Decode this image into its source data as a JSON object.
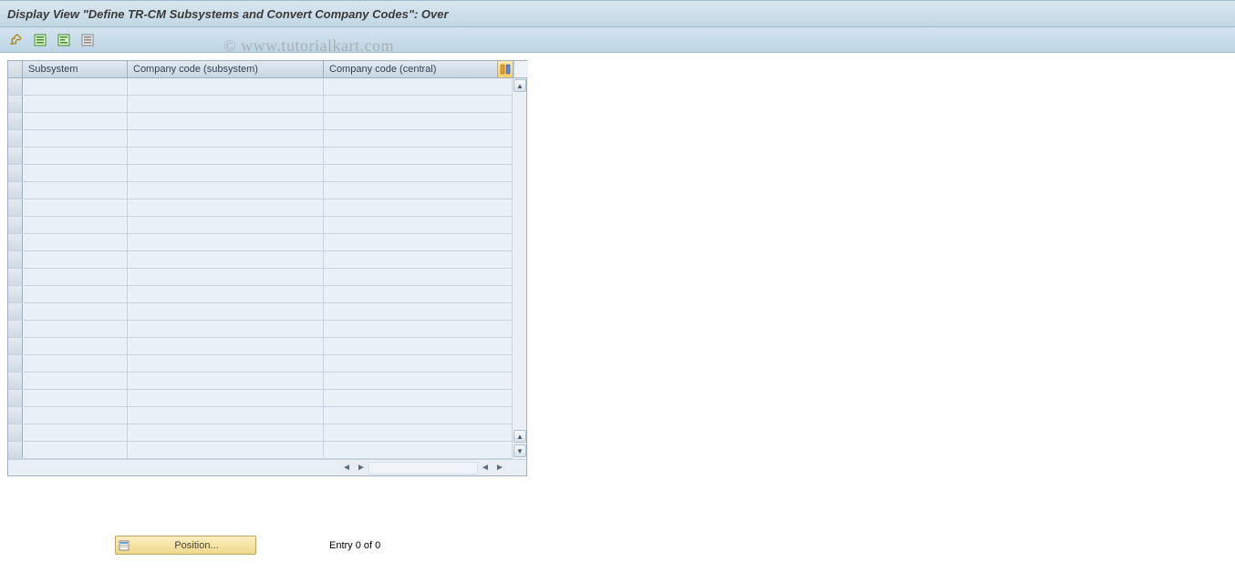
{
  "title": "Display View \"Define TR-CM Subsystems and Convert Company Codes\": Over",
  "toolbar": {
    "icons": [
      "edit-icon",
      "doc-icon",
      "doc2-icon",
      "doc3-icon"
    ]
  },
  "table": {
    "columns": {
      "subsystem": "Subsystem",
      "company_sub": "Company code (subsystem)",
      "company_cen": "Company code (central)"
    },
    "rows": [
      {
        "subsystem": "",
        "company_sub": "",
        "company_cen": ""
      },
      {
        "subsystem": "",
        "company_sub": "",
        "company_cen": ""
      },
      {
        "subsystem": "",
        "company_sub": "",
        "company_cen": ""
      },
      {
        "subsystem": "",
        "company_sub": "",
        "company_cen": ""
      },
      {
        "subsystem": "",
        "company_sub": "",
        "company_cen": ""
      },
      {
        "subsystem": "",
        "company_sub": "",
        "company_cen": ""
      },
      {
        "subsystem": "",
        "company_sub": "",
        "company_cen": ""
      },
      {
        "subsystem": "",
        "company_sub": "",
        "company_cen": ""
      },
      {
        "subsystem": "",
        "company_sub": "",
        "company_cen": ""
      },
      {
        "subsystem": "",
        "company_sub": "",
        "company_cen": ""
      },
      {
        "subsystem": "",
        "company_sub": "",
        "company_cen": ""
      },
      {
        "subsystem": "",
        "company_sub": "",
        "company_cen": ""
      },
      {
        "subsystem": "",
        "company_sub": "",
        "company_cen": ""
      },
      {
        "subsystem": "",
        "company_sub": "",
        "company_cen": ""
      },
      {
        "subsystem": "",
        "company_sub": "",
        "company_cen": ""
      },
      {
        "subsystem": "",
        "company_sub": "",
        "company_cen": ""
      },
      {
        "subsystem": "",
        "company_sub": "",
        "company_cen": ""
      },
      {
        "subsystem": "",
        "company_sub": "",
        "company_cen": ""
      },
      {
        "subsystem": "",
        "company_sub": "",
        "company_cen": ""
      },
      {
        "subsystem": "",
        "company_sub": "",
        "company_cen": ""
      },
      {
        "subsystem": "",
        "company_sub": "",
        "company_cen": ""
      },
      {
        "subsystem": "",
        "company_sub": "",
        "company_cen": ""
      }
    ]
  },
  "footer": {
    "position_label": "Position...",
    "entry_text": "Entry 0 of 0"
  },
  "watermark": "© www.tutorialkart.com"
}
